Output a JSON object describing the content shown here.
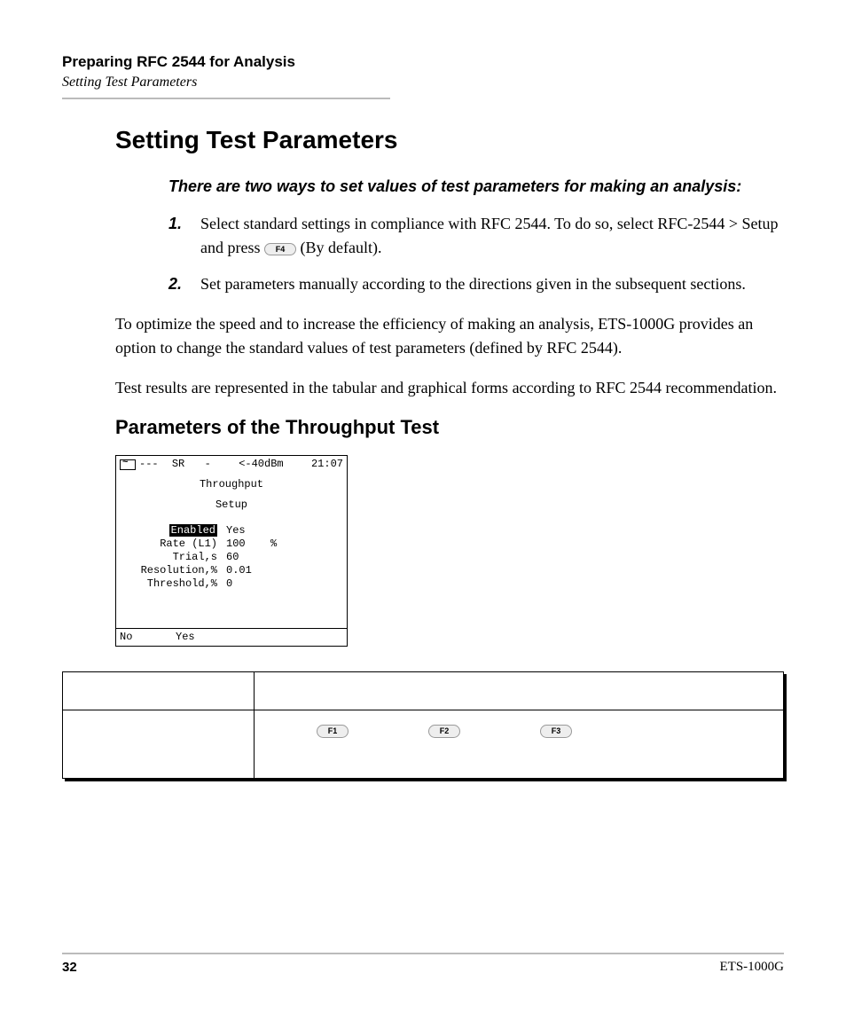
{
  "header": {
    "chapter": "Preparing RFC 2544 for Analysis",
    "section": "Setting Test Parameters"
  },
  "title": "Setting Test Parameters",
  "lead": "There are two ways to set values of test parameters for making an analysis:",
  "step1_a": "Select standard settings in compliance with RFC 2544. To do so, select RFC-2544 > Setup and press ",
  "step1_key": "F4",
  "step1_b": " (By default).",
  "step2": "Set parameters manually according to the directions given in the subsequent sections.",
  "para1": "To optimize the speed and to increase the efficiency of making an analysis, ETS-1000G provides an option to change the standard values of test parameters (defined by RFC 2544).",
  "para2": "Test results are represented in the tabular and graphical forms according to RFC 2544 recommendation.",
  "subsection": "Parameters of the Throughput Test",
  "screen": {
    "status": {
      "dashes": "---",
      "sr": "SR",
      "dash": "-",
      "dbm": "<-40dBm",
      "time": "21:07"
    },
    "title1": "Throughput",
    "title2": "Setup",
    "params": {
      "enabled_label": "Enabled",
      "enabled_value": "Yes",
      "rate_label": "Rate (L1)",
      "rate_value": "100",
      "rate_unit": "%",
      "trial_label": "Trial,s",
      "trial_value": "60",
      "res_label": "Resolution,%",
      "res_value": "0.01",
      "thresh_label": "Threshold,%",
      "thresh_value": "0"
    },
    "soft": {
      "no": "No",
      "yes": "Yes"
    }
  },
  "table_keys": {
    "f1": "F1",
    "f2": "F2",
    "f3": "F3"
  },
  "footer": {
    "page": "32",
    "product": "ETS-1000G"
  }
}
